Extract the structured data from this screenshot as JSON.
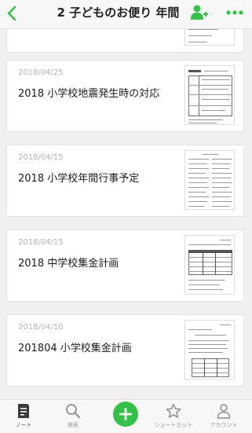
{
  "header": {
    "title": "2 子どものお便り 年間"
  },
  "notes": [
    {
      "date": "",
      "title": ""
    },
    {
      "date": "2018/04/25",
      "title": "2018 小学校地震発生時の対応"
    },
    {
      "date": "2018/04/15",
      "title": "2018 小学校年間行事予定"
    },
    {
      "date": "2018/04/15",
      "title": "2018 中学校集金計画"
    },
    {
      "date": "2018/04/10",
      "title": "201804 小学校集金計画"
    }
  ],
  "tabbar": {
    "items": [
      {
        "label": "ノート",
        "icon": "note-icon",
        "active": true
      },
      {
        "label": "検索",
        "icon": "search-icon"
      },
      {
        "label": "",
        "icon": "plus-icon"
      },
      {
        "label": "ショートカット",
        "icon": "star-icon"
      },
      {
        "label": "アカウント",
        "icon": "person-icon"
      }
    ]
  },
  "colors": {
    "accent": "#33c148",
    "header_bg": "#f7f7f7",
    "list_bg": "#f0f0f0"
  }
}
